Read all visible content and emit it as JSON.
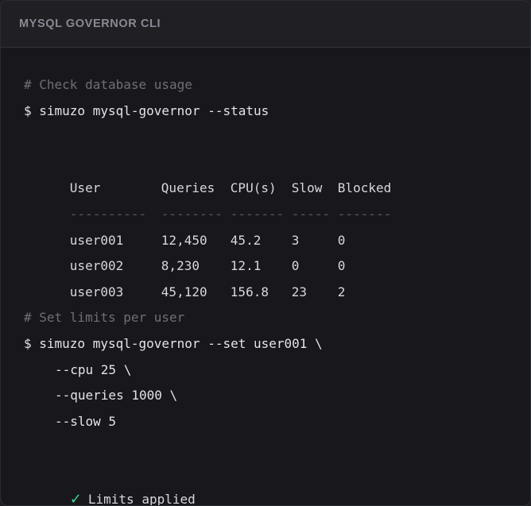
{
  "header": {
    "title": "MYSQL GOVERNOR CLI"
  },
  "terminal": {
    "comment_status": "# Check database usage",
    "cmd_status": "$ simuzo mysql-governor --status",
    "table": {
      "headers": [
        "User",
        "Queries",
        "CPU(s)",
        "Slow",
        "Blocked"
      ],
      "separators": [
        "----------",
        "--------",
        "-------",
        "-----",
        "-------"
      ],
      "rows": [
        [
          "user001",
          "12,450",
          "45.2",
          "3",
          "0"
        ],
        [
          "user002",
          "8,230",
          "12.1",
          "0",
          "0"
        ],
        [
          "user003",
          "45,120",
          "156.8",
          "23",
          "2"
        ]
      ]
    },
    "comment_limits": "# Set limits per user",
    "cmd_set": "$ simuzo mysql-governor --set user001 \\",
    "cmd_cpu": "--cpu 25 \\",
    "cmd_queries": "--queries 1000 \\",
    "cmd_slow": "--slow 5",
    "check_icon": "✓",
    "success_text": "Limits applied",
    "colors": {
      "success": "#3dd68c",
      "comment": "#6e6e78",
      "text": "#d7d7dc"
    }
  }
}
